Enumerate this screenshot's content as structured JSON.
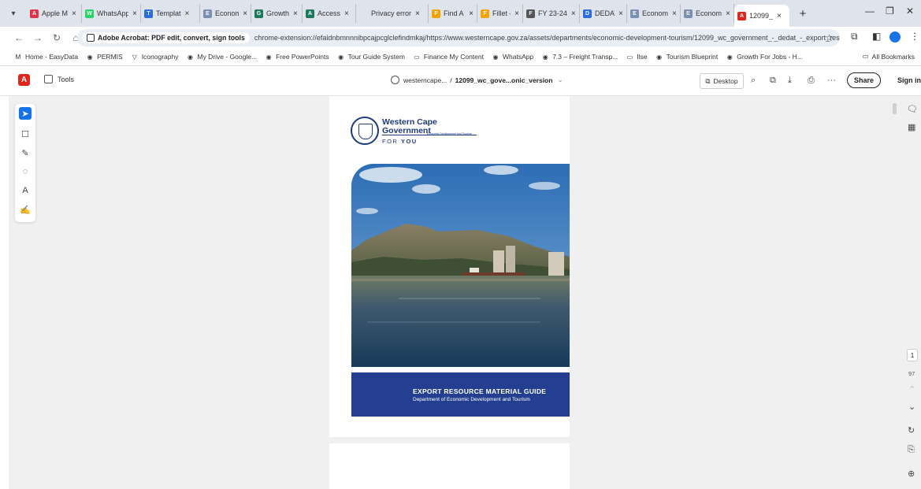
{
  "browser": {
    "tabs": [
      {
        "title": "Apple M",
        "fav": "A",
        "color": "#e0334c"
      },
      {
        "title": "WhatsApp",
        "fav": "W",
        "color": "#25d366"
      },
      {
        "title": "Templat",
        "fav": "T",
        "color": "#2b6cde"
      },
      {
        "title": "Econom",
        "fav": "E",
        "color": "#7a8fb3"
      },
      {
        "title": "Growth",
        "fav": "G",
        "color": "#1b7a5c"
      },
      {
        "title": "Access",
        "fav": "A",
        "color": "#1b7a5c"
      },
      {
        "title": "Privacy error",
        "fav": "",
        "color": "#dfe3eb"
      },
      {
        "title": "Find A S",
        "fav": "F",
        "color": "#f4a300"
      },
      {
        "title": "Fillet –",
        "fav": "F",
        "color": "#f4a300"
      },
      {
        "title": "FY 23-24",
        "fav": "F",
        "color": "#555"
      },
      {
        "title": "DEDAT",
        "fav": "D",
        "color": "#2b6cde"
      },
      {
        "title": "Econom",
        "fav": "E",
        "color": "#7a8fb3"
      },
      {
        "title": "Econom",
        "fav": "E",
        "color": "#7a8fb3"
      },
      {
        "title": "12099_",
        "fav": "A",
        "color": "#e1251b",
        "active": true
      }
    ],
    "new_tab": "+",
    "minimize": "—",
    "maximize": "❐",
    "close": "✕",
    "site_chip": "Adobe Acrobat: PDF edit, convert, sign tools",
    "url": "chrome-extension://efaidnbmnnnibpcajpcglclefindmkaj/https://www.westerncape.gov.za/assets/departments/economic-development-tourism/12099_wc_government_-_dedat_-_export_resource_material...",
    "bookmarks": [
      {
        "label": "Home - EasyData",
        "icon": "M"
      },
      {
        "label": "PERMIS",
        "icon": "◉"
      },
      {
        "label": "Iconography",
        "icon": "▽"
      },
      {
        "label": "My Drive - Google...",
        "icon": "◉"
      },
      {
        "label": "Free PowerPoints",
        "icon": "◉"
      },
      {
        "label": "Tour Guide System",
        "icon": "◉"
      },
      {
        "label": "Finance My Content",
        "icon": "▭"
      },
      {
        "label": "WhatsApp",
        "icon": "◉"
      },
      {
        "label": "7.3 – Freight Transp...",
        "icon": "◉"
      },
      {
        "label": "Ilse",
        "icon": "▭"
      },
      {
        "label": "Tourism Blueprint",
        "icon": "◉"
      },
      {
        "label": "Growth For Jobs - H...",
        "icon": "◉"
      }
    ],
    "all_bookmarks": "All Bookmarks"
  },
  "acrobat": {
    "tools_label": "Tools",
    "doc_host": "westerncape...",
    "doc_sep": "/",
    "doc_name": "12099_wc_gove...onic_version",
    "desktop_label": "Desktop",
    "share_label": "Share",
    "signin_label": "Sign in",
    "page_current": "1",
    "page_total": "97"
  },
  "cover": {
    "org_line1": "Western Cape",
    "org_line2": "Government",
    "for": "FOR",
    "you": "YOU",
    "dept_small": "Economic Development and Tourism",
    "title": "EXPORT RESOURCE MATERIAL GUIDE",
    "subtitle": "Department of Economic Development and Tourism"
  }
}
